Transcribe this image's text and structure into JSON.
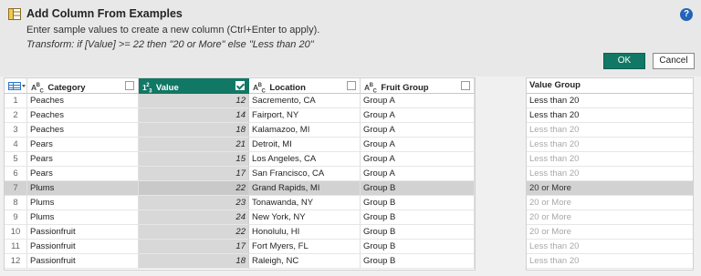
{
  "dialog": {
    "title": "Add Column From Examples",
    "description": "Enter sample values to create a new column (Ctrl+Enter to apply).",
    "transform": "Transform: if [Value] >= 22 then \"20 or More\" else \"Less than 20\"",
    "help_icon": "?",
    "ok_label": "OK",
    "cancel_label": "Cancel",
    "accent_color": "#117865"
  },
  "columns": [
    {
      "label": "Category",
      "type_icon": "ABC",
      "selected": false
    },
    {
      "label": "Value",
      "type_icon": "123",
      "selected": true
    },
    {
      "label": "Location",
      "type_icon": "ABC",
      "selected": false
    },
    {
      "label": "Fruit Group",
      "type_icon": "ABC",
      "selected": false
    }
  ],
  "rows": [
    {
      "num": "1",
      "category": "Peaches",
      "value": "12",
      "location": "Sacremento, CA",
      "group": "Group A"
    },
    {
      "num": "2",
      "category": "Peaches",
      "value": "14",
      "location": "Fairport, NY",
      "group": "Group A"
    },
    {
      "num": "3",
      "category": "Peaches",
      "value": "18",
      "location": "Kalamazoo, MI",
      "group": "Group A"
    },
    {
      "num": "4",
      "category": "Pears",
      "value": "21",
      "location": "Detroit, MI",
      "group": "Group A"
    },
    {
      "num": "5",
      "category": "Pears",
      "value": "15",
      "location": "Los Angeles, CA",
      "group": "Group A"
    },
    {
      "num": "6",
      "category": "Pears",
      "value": "17",
      "location": "San Francisco, CA",
      "group": "Group A"
    },
    {
      "num": "7",
      "category": "Plums",
      "value": "22",
      "location": "Grand Rapids, MI",
      "group": "Group B"
    },
    {
      "num": "8",
      "category": "Plums",
      "value": "23",
      "location": "Tonawanda, NY",
      "group": "Group B"
    },
    {
      "num": "9",
      "category": "Plums",
      "value": "24",
      "location": "New York, NY",
      "group": "Group B"
    },
    {
      "num": "10",
      "category": "Passionfruit",
      "value": "22",
      "location": "Honolulu, HI",
      "group": "Group B"
    },
    {
      "num": "11",
      "category": "Passionfruit",
      "value": "17",
      "location": "Fort Myers, FL",
      "group": "Group B"
    },
    {
      "num": "12",
      "category": "Passionfruit",
      "value": "18",
      "location": "Raleigh, NC",
      "group": "Group B"
    }
  ],
  "value_group": {
    "header": "Value Group",
    "values": [
      {
        "text": "Less than 20",
        "state": "entered"
      },
      {
        "text": "Less than 20",
        "state": "entered"
      },
      {
        "text": "Less than 20",
        "state": "suggested"
      },
      {
        "text": "Less than 20",
        "state": "suggested"
      },
      {
        "text": "Less than 20",
        "state": "suggested"
      },
      {
        "text": "Less than 20",
        "state": "suggested"
      },
      {
        "text": "20 or More",
        "state": "entered"
      },
      {
        "text": "20 or More",
        "state": "suggested"
      },
      {
        "text": "20 or More",
        "state": "suggested"
      },
      {
        "text": "20 or More",
        "state": "suggested"
      },
      {
        "text": "Less than 20",
        "state": "suggested"
      },
      {
        "text": "Less than 20",
        "state": "suggested"
      }
    ]
  },
  "highlighted_row": 6
}
